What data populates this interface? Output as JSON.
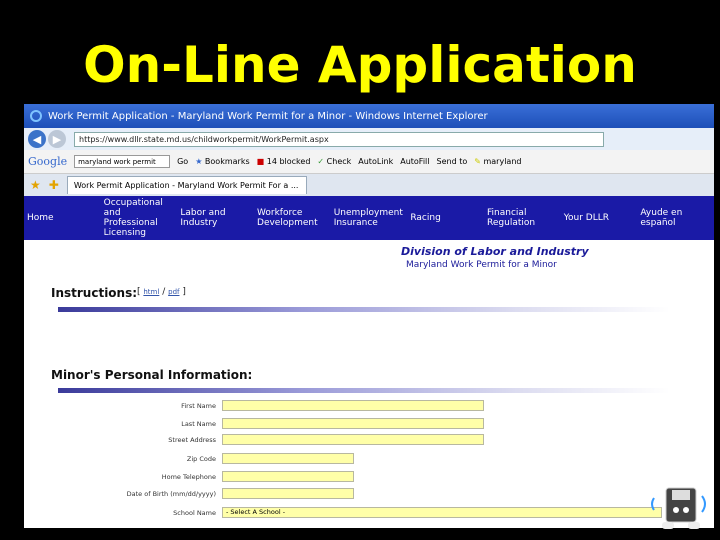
{
  "slide": {
    "title": "On-Line Application"
  },
  "browser": {
    "window_title": "Work Permit Application - Maryland Work Permit for a Minor - Windows Internet Explorer",
    "url": "https://www.dllr.state.md.us/childworkpermit/WorkPermit.aspx",
    "tab_label": "Work Permit Application - Maryland Work Permit For a ...",
    "google_toolbar": {
      "logo": "Google",
      "search_value": "maryland work permit",
      "go_label": "Go",
      "bookmarks_label": "Bookmarks",
      "blocked_label": "14 blocked",
      "check_label": "Check",
      "autolink_label": "AutoLink",
      "autofill_label": "AutoFill",
      "sendto_label": "Send to",
      "highlight_label": "maryland"
    }
  },
  "site_nav": [
    "Home",
    "Occupational and Professional Licensing",
    "Labor and Industry",
    "Workforce Development",
    "Unemployment Insurance",
    "Racing",
    "Financial Regulation",
    "Your DLLR",
    "Ayude en español"
  ],
  "page": {
    "division": "Division of Labor and Industry",
    "subtitle": "Maryland Work Permit for a Minor",
    "instructions_heading": "Instructions:",
    "instructions_links": {
      "html": "html",
      "sep": "/",
      "pdf": "pdf"
    },
    "minor_heading": "Minor's Personal Information:",
    "fields": [
      {
        "label": "First Name",
        "value": ""
      },
      {
        "label": "Last Name",
        "value": ""
      },
      {
        "label": "Street Address",
        "value": ""
      },
      {
        "label": "Zip Code",
        "value": ""
      },
      {
        "label": "Home Telephone",
        "value": ""
      },
      {
        "label": "Date of Birth (mm/dd/yyyy)",
        "value": ""
      },
      {
        "label": "School Name",
        "value": "- Select A School -"
      }
    ]
  }
}
